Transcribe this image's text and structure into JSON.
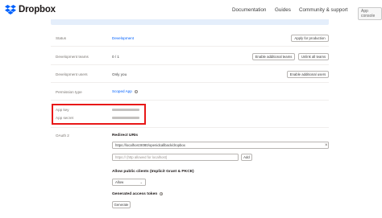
{
  "header": {
    "brand": "Dropbox",
    "nav": [
      "Documentation",
      "Guides",
      "Community & support"
    ],
    "console_button": "App console"
  },
  "settings": {
    "status": {
      "label": "Status",
      "value": "Development",
      "button": "Apply for production"
    },
    "dev_teams": {
      "label": "Development teams",
      "value": "0 / 1",
      "button_enable": "Enable additional teams",
      "button_unlink": "Unlink all teams"
    },
    "dev_users": {
      "label": "Development users",
      "value": "Only you",
      "button": "Enable additional users"
    },
    "permission": {
      "label": "Permission type",
      "value": "Scoped App"
    },
    "app_key": {
      "label": "App key"
    },
    "app_secret": {
      "label": "App secret"
    },
    "oauth": {
      "label": "OAuth 2",
      "redirect_title": "Redirect URIs",
      "redirect_uri": "https://localhost:8080/openidcallback/dropbox",
      "redirect_placeholder": "https:// (http allowed for localhost)",
      "add_button": "Add",
      "pkce_title": "Allow public clients (Implicit Grant & PKCE)",
      "pkce_value": "Allow",
      "token_title": "Generated access token",
      "generate_button": "Generate"
    }
  },
  "colors": {
    "accent": "#0061fe",
    "highlight_box": "#e81818",
    "banner": "#e4eefb"
  }
}
